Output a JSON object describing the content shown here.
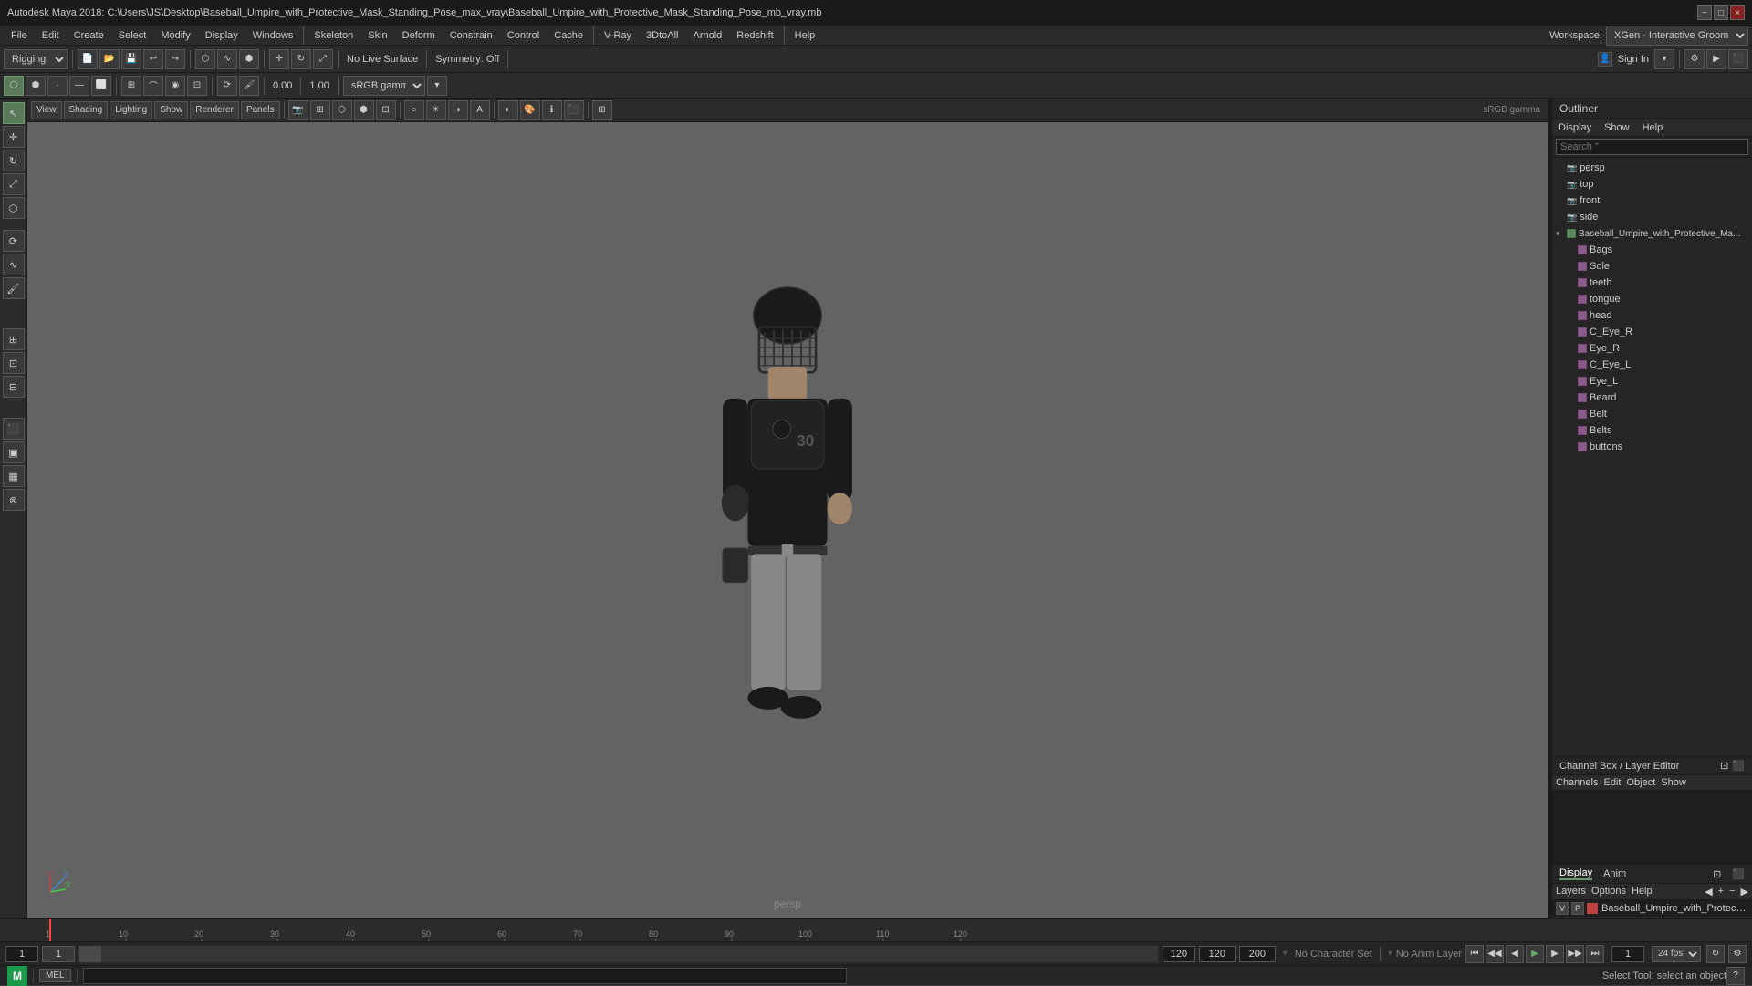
{
  "titlebar": {
    "title": "Autodesk Maya 2018: C:\\Users\\JS\\Desktop\\Baseball_Umpire_with_Protective_Mask_Standing_Pose_max_vray\\Baseball_Umpire_with_Protective_Mask_Standing_Pose_mb_vray.mb",
    "controls": [
      "−",
      "□",
      "×"
    ]
  },
  "menus": {
    "items": [
      "File",
      "Edit",
      "Create",
      "Select",
      "Modify",
      "Display",
      "Windows",
      "Skeleton",
      "Skin",
      "Deform",
      "Constrain",
      "Control",
      "Cache",
      "V-Ray",
      "3DtoAll",
      "Arnold",
      "Redshift",
      "Help"
    ]
  },
  "toolbar1": {
    "workspace_label": "Workspace:",
    "workspace_value": "XGen - Interactive Groom",
    "rigging_label": "Rigging"
  },
  "viewport": {
    "label": "persp",
    "no_live_surface": "No Live Surface",
    "symmetry_off": "Symmetry: Off",
    "view_menu": "View",
    "shading_menu": "Shading",
    "lighting_menu": "Lighting",
    "show_menu": "Show",
    "renderer_menu": "Renderer",
    "panels_menu": "Panels",
    "gamma_value": "sRGB gamma",
    "focal_value": "0.00",
    "camera_value": "1.00"
  },
  "outliner": {
    "title": "Outliner",
    "menus": [
      "Display",
      "Show",
      "Help"
    ],
    "search_placeholder": "Search \"",
    "items": [
      {
        "name": "persp",
        "type": "camera",
        "indent": 0
      },
      {
        "name": "top",
        "type": "camera",
        "indent": 0
      },
      {
        "name": "front",
        "type": "camera",
        "indent": 0
      },
      {
        "name": "side",
        "type": "camera",
        "indent": 0
      },
      {
        "name": "Baseball_Umpire_with_Protective_Ma...",
        "type": "group",
        "indent": 0,
        "expanded": true
      },
      {
        "name": "Bags",
        "type": "mesh",
        "indent": 1
      },
      {
        "name": "Sole",
        "type": "mesh",
        "indent": 1
      },
      {
        "name": "teeth",
        "type": "mesh",
        "indent": 1
      },
      {
        "name": "tongue",
        "type": "mesh",
        "indent": 1
      },
      {
        "name": "head",
        "type": "mesh",
        "indent": 1
      },
      {
        "name": "C_Eye_R",
        "type": "mesh",
        "indent": 1
      },
      {
        "name": "Eye_R",
        "type": "mesh",
        "indent": 1
      },
      {
        "name": "C_Eye_L",
        "type": "mesh",
        "indent": 1
      },
      {
        "name": "Eye_L",
        "type": "mesh",
        "indent": 1
      },
      {
        "name": "Beard",
        "type": "mesh",
        "indent": 1
      },
      {
        "name": "Belt",
        "type": "mesh",
        "indent": 1
      },
      {
        "name": "Belts",
        "type": "mesh",
        "indent": 1
      },
      {
        "name": "buttons",
        "type": "mesh",
        "indent": 1
      }
    ]
  },
  "channel_box": {
    "title": "Channel Box / Layer Editor",
    "menus": [
      "Channels",
      "Edit",
      "Object",
      "Show"
    ]
  },
  "display_panel": {
    "tabs": [
      "Display",
      "Anim"
    ],
    "active_tab": "Display",
    "submenus": [
      "Layers",
      "Options",
      "Help"
    ],
    "layer": {
      "v": "V",
      "p": "P",
      "color": "#c04040",
      "name": "Baseball_Umpire_with_Protective_M..."
    }
  },
  "timeline": {
    "start_frame": "1",
    "end_frame": "120",
    "current_frame": "1",
    "range_start": "1",
    "range_end": "120",
    "anim_end": "200",
    "fps": "24 fps",
    "ruler_marks": [
      "1",
      "10",
      "20",
      "30",
      "40",
      "50",
      "60",
      "70",
      "80",
      "90",
      "100",
      "110",
      "120"
    ]
  },
  "statusbar": {
    "lang": "MEL",
    "status_text": "Select Tool: select an object",
    "no_character_set": "No Character Set",
    "no_anim_layer": "No Anim Layer"
  },
  "icons": {
    "arrow": "▶",
    "back_arrow": "◀",
    "play": "▶",
    "stop": "■",
    "skip_forward": "⏭",
    "skip_back": "⏮",
    "step_forward": "⏩",
    "step_back": "⏪",
    "loop": "🔁"
  }
}
